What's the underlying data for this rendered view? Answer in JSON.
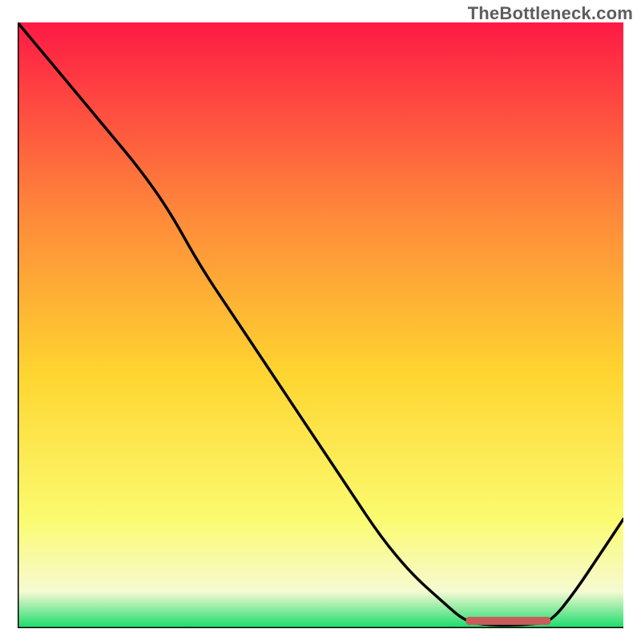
{
  "watermark": "TheBottleneck.com",
  "colors": {
    "gradient_top": "#fe1a45",
    "gradient_upper_mid": "#fe8a3a",
    "gradient_mid": "#fed530",
    "gradient_lower_mid": "#fbfb70",
    "gradient_near_bottom": "#f6fad2",
    "gradient_bottom": "#17db6a",
    "curve": "#000000",
    "marker": "#c95b5b",
    "axis": "#000000"
  },
  "chart_data": {
    "type": "line",
    "title": "",
    "xlabel": "",
    "ylabel": "",
    "xlim": [
      0,
      100
    ],
    "ylim": [
      0,
      100
    ],
    "grid": false,
    "legend": false,
    "annotations": [
      {
        "kind": "marker_bar",
        "x0": 74,
        "x1": 88,
        "y": 1.2
      }
    ],
    "series": [
      {
        "name": "bottleneck-curve",
        "x": [
          0,
          5,
          10,
          15,
          20,
          25,
          30,
          35,
          40,
          45,
          50,
          55,
          60,
          65,
          70,
          74,
          78,
          82,
          85,
          88,
          92,
          96,
          100
        ],
        "y": [
          100,
          94,
          88,
          82,
          76,
          69,
          60,
          52.5,
          45,
          37.5,
          30,
          22.5,
          15,
          9,
          4.5,
          1.0,
          0.5,
          0.5,
          0.7,
          1.0,
          6,
          12,
          18
        ]
      }
    ]
  }
}
